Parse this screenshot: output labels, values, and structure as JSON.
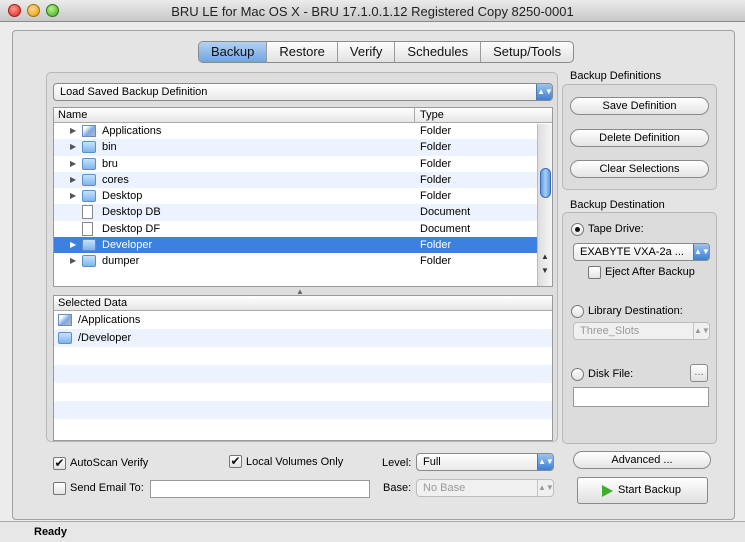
{
  "window": {
    "title": "BRU LE for Mac OS X - BRU 17.1.0.1.12 Registered Copy 8250-0001"
  },
  "tabs": [
    {
      "label": "Backup",
      "active": true
    },
    {
      "label": "Restore",
      "active": false
    },
    {
      "label": "Verify",
      "active": false
    },
    {
      "label": "Schedules",
      "active": false
    },
    {
      "label": "Setup/Tools",
      "active": false
    }
  ],
  "load_definition": {
    "label": "Load Saved Backup Definition"
  },
  "file_table": {
    "columns": [
      "Name",
      "Type"
    ],
    "rows": [
      {
        "name": "Applications",
        "type": "Folder",
        "icon": "application-folder-icon",
        "expandable": true,
        "selected": false
      },
      {
        "name": "bin",
        "type": "Folder",
        "icon": "folder-icon",
        "expandable": true,
        "selected": false
      },
      {
        "name": "bru",
        "type": "Folder",
        "icon": "folder-icon",
        "expandable": true,
        "selected": false
      },
      {
        "name": "cores",
        "type": "Folder",
        "icon": "folder-icon",
        "expandable": true,
        "selected": false
      },
      {
        "name": "Desktop",
        "type": "Folder",
        "icon": "folder-icon",
        "expandable": true,
        "selected": false
      },
      {
        "name": "Desktop DB",
        "type": "Document",
        "icon": "document-icon",
        "expandable": false,
        "selected": false
      },
      {
        "name": "Desktop DF",
        "type": "Document",
        "icon": "document-icon",
        "expandable": false,
        "selected": false
      },
      {
        "name": "Developer",
        "type": "Folder",
        "icon": "developer-folder-icon",
        "expandable": true,
        "selected": true
      },
      {
        "name": "dumper",
        "type": "Folder",
        "icon": "folder-icon",
        "expandable": true,
        "selected": false
      }
    ]
  },
  "selected_data": {
    "header": "Selected Data",
    "items": [
      {
        "path": "/Applications",
        "icon": "application-folder-icon"
      },
      {
        "path": "/Developer",
        "icon": "developer-folder-icon"
      }
    ]
  },
  "options": {
    "autoscan_verify": {
      "label": "AutoScan Verify",
      "checked": true
    },
    "local_volumes_only": {
      "label": "Local Volumes Only",
      "checked": true
    },
    "send_email": {
      "label": "Send Email To:",
      "checked": false,
      "value": ""
    },
    "level": {
      "label": "Level:",
      "value": "Full"
    },
    "base": {
      "label": "Base:",
      "value": "No Base"
    }
  },
  "backup_definitions": {
    "title": "Backup Definitions",
    "save": "Save Definition",
    "delete": "Delete Definition",
    "clear": "Clear Selections"
  },
  "backup_destination": {
    "title": "Backup Destination",
    "tape_drive": {
      "label": "Tape Drive:",
      "selected": true,
      "value": "EXABYTE VXA-2a ..."
    },
    "eject_after_backup": {
      "label": "Eject After Backup",
      "checked": false
    },
    "library_destination": {
      "label": "Library Destination:",
      "selected": false,
      "value": "Three_Slots"
    },
    "disk_file": {
      "label": "Disk File:",
      "selected": false,
      "browse": "...",
      "value": ""
    }
  },
  "actions": {
    "advanced": "Advanced ...",
    "start_backup": "Start Backup"
  },
  "status": {
    "text": "Ready"
  },
  "colors": {
    "selection": "#3d80df",
    "accent_blue": "#6fa5e0",
    "start_icon": "#3fae2a"
  }
}
